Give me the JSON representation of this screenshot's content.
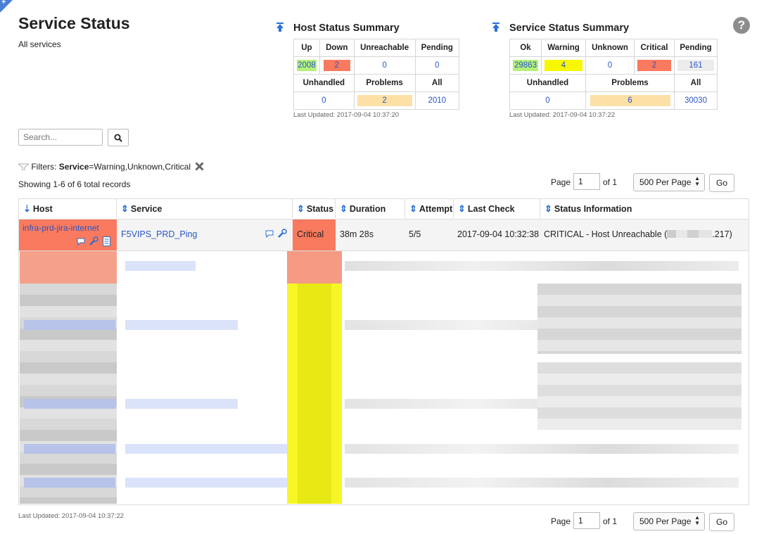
{
  "page": {
    "title": "Service Status",
    "subtitle": "All services",
    "help_icon": "question-circle-icon"
  },
  "host_summary": {
    "title": "Host Status Summary",
    "headers": [
      "Up",
      "Down",
      "Unreachable",
      "Pending"
    ],
    "values": [
      "2008",
      "2",
      "0",
      "0"
    ],
    "headers2": [
      "Unhandled",
      "Problems",
      "All"
    ],
    "values2": [
      "0",
      "2",
      "2010"
    ],
    "last_updated": "Last Updated: 2017-09-04 10:37:20"
  },
  "service_summary": {
    "title": "Service Status Summary",
    "headers": [
      "Ok",
      "Warning",
      "Unknown",
      "Critical",
      "Pending"
    ],
    "values": [
      "29863",
      "4",
      "0",
      "2",
      "161"
    ],
    "headers2": [
      "Unhandled",
      "Problems",
      "All"
    ],
    "values2": [
      "0",
      "6",
      "30030"
    ],
    "last_updated": "Last Updated: 2017-09-04 10:37:22"
  },
  "search": {
    "placeholder": "Search..."
  },
  "filters": {
    "label": "Filters:",
    "key": "Service",
    "value": "=Warning,Unknown,Critical"
  },
  "records": {
    "showing": "Showing 1-6 of 6 total records"
  },
  "pager": {
    "page_label": "Page",
    "page_value": "1",
    "of_label": "of 1",
    "per_page": "500 Per Page",
    "go": "Go"
  },
  "table": {
    "columns": [
      "Host",
      "Service",
      "Status",
      "Duration",
      "Attempt",
      "Last Check",
      "Status Information"
    ],
    "row1": {
      "host": "infra-prd-jira-internet",
      "service": "F5VIPS_PRD_Ping",
      "status": "Critical",
      "duration": "38m 28s",
      "attempt": "5/5",
      "last_check": "2017-09-04 10:32:38",
      "info_prefix": "CRITICAL - Host Unreachable (",
      "info_suffix": ".217)"
    }
  },
  "colors": {
    "critical": "#f97a5e",
    "warning": "#f7f700",
    "ok": "#b4f07a",
    "problems": "#fde0a6",
    "pending": "#ececec",
    "link": "#2a56c6"
  },
  "footer": {
    "last_updated": "Last Updated: 2017-09-04 10:37:22"
  }
}
